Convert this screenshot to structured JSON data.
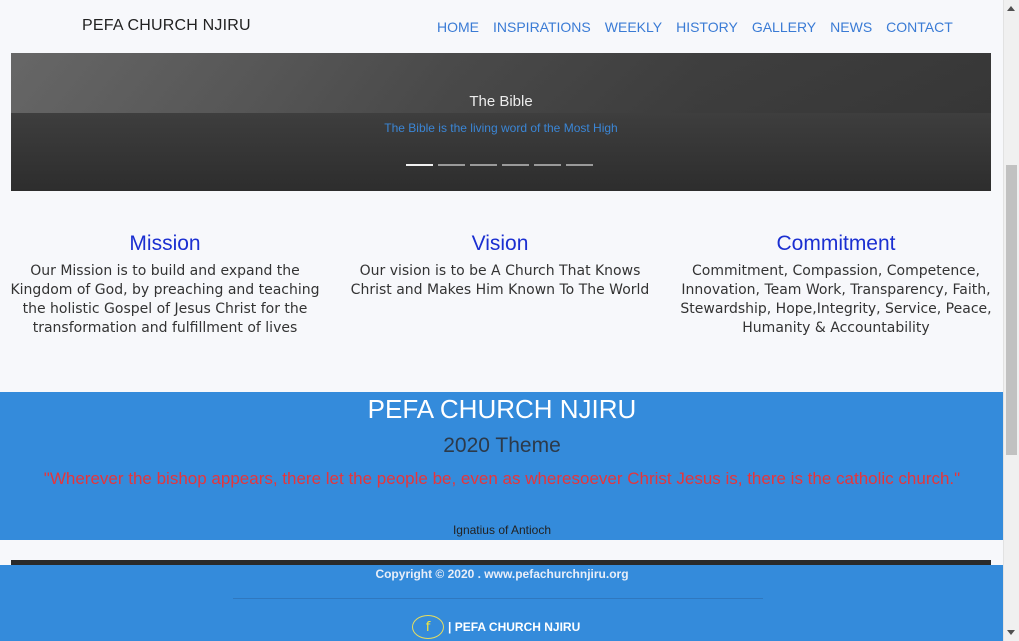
{
  "navbar": {
    "brand": "PEFA CHURCH NJIRU",
    "links": [
      "HOME",
      "INSPIRATIONS",
      "WEEKLY",
      "HISTORY",
      "GALLERY",
      "NEWS",
      "CONTACT"
    ]
  },
  "hero": {
    "title": "The Bible",
    "subtitle": "The Bible is the living word of the Most High",
    "slides": 6,
    "active_slide": 1
  },
  "columns": [
    {
      "heading": "Mission",
      "text": "Our Mission is to build and expand the Kingdom of God, by preaching and teaching the holistic Gospel of Jesus Christ for the transformation and fulfillment of lives"
    },
    {
      "heading": "Vision",
      "text": "Our vision is to be A Church That Knows Christ and Makes Him Known To The World"
    },
    {
      "heading": "Commitment",
      "text": "Commitment, Compassion, Competence, Innovation, Team Work, Transparency, Faith, Stewardship, Hope,Integrity, Service, Peace, Humanity & Accountability"
    }
  ],
  "theme": {
    "title": "PEFA CHURCH NJIRU",
    "year_theme": "2020 Theme",
    "quote": "\"Wherever the bishop appears, there let the people be, even as wheresoever Christ Jesus is, there is the catholic church.\"",
    "author": "Ignatius of Antioch"
  },
  "footer": {
    "copyright": "Copyright © 2020 . www.pefachurchnjiru.org",
    "facebook_icon": "facebook-icon",
    "facebook_label": "| PEFA CHURCH NJIRU"
  },
  "colors": {
    "accent": "#348bdb",
    "link": "#3a7bd5",
    "heading": "#1b2fd1",
    "quote": "#e6353b"
  }
}
